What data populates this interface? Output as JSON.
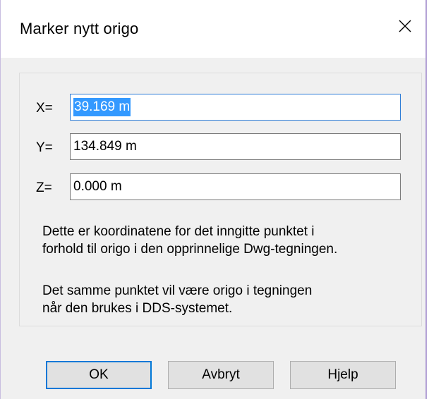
{
  "dialog": {
    "title": "Marker nytt origo",
    "close_icon": "close-icon"
  },
  "fields": [
    {
      "label": "X=",
      "value": "39.169 m",
      "selected": true
    },
    {
      "label": "Y=",
      "value": "134.849 m",
      "selected": false
    },
    {
      "label": "Z=",
      "value": "0.000 m",
      "selected": false
    }
  ],
  "info": {
    "paragraph1_line1": "Dette er koordinatene for det inngitte punktet i",
    "paragraph1_line2": "forhold til origo i den opprinnelige Dwg-tegningen.",
    "paragraph2_line1": "Det samme punktet vil være origo i tegningen",
    "paragraph2_line2": "når den brukes i DDS-systemet."
  },
  "buttons": {
    "ok": "OK",
    "cancel": "Avbryt",
    "help": "Hjelp"
  },
  "colors": {
    "selection": "#3399ff",
    "focus_border": "#0078d7",
    "dialog_bg": "#f0f0f0"
  }
}
